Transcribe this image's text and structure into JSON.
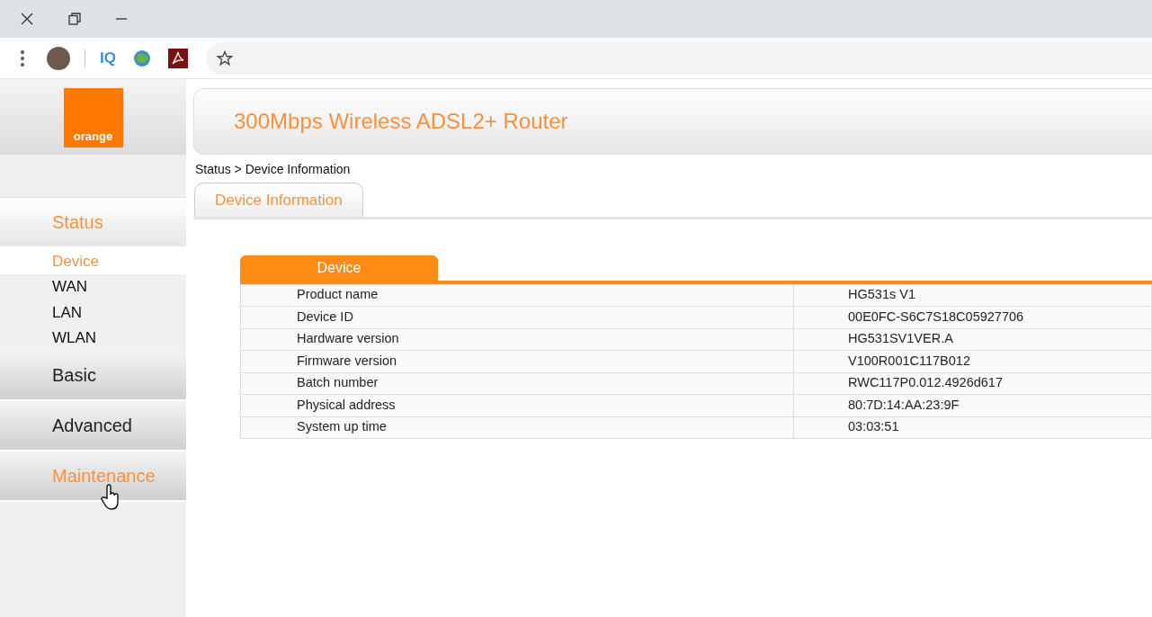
{
  "browser": {
    "extension_label": "IQ"
  },
  "logo": {
    "text": "orange"
  },
  "header": {
    "title": "300Mbps Wireless ADSL2+ Router"
  },
  "breadcrumb": "Status > Device Information",
  "tabs": [
    {
      "label": "Device Information",
      "selected": true
    }
  ],
  "sidebar": {
    "sections": [
      {
        "label": "Status",
        "selected": true,
        "hovered": false,
        "children": [
          {
            "label": "Device",
            "selected": true
          },
          {
            "label": "WAN",
            "selected": false
          },
          {
            "label": "LAN",
            "selected": false
          },
          {
            "label": "WLAN",
            "selected": false
          }
        ]
      },
      {
        "label": "Basic",
        "selected": false,
        "hovered": false
      },
      {
        "label": "Advanced",
        "selected": false,
        "hovered": false
      },
      {
        "label": "Maintenance",
        "selected": false,
        "hovered": true
      }
    ]
  },
  "panel": {
    "title": "Device",
    "rows": [
      {
        "label": "Product name",
        "value": "HG531s V1"
      },
      {
        "label": "Device ID",
        "value": "00E0FC-S6C7S18C05927706"
      },
      {
        "label": "Hardware version",
        "value": "HG531SV1VER.A"
      },
      {
        "label": "Firmware version",
        "value": "V100R001C117B012"
      },
      {
        "label": "Batch number",
        "value": "RWC117P0.012.4926d617"
      },
      {
        "label": "Physical address",
        "value": "80:7D:14:AA:23:9F"
      },
      {
        "label": "System up time",
        "value": "03:03:51"
      }
    ]
  }
}
